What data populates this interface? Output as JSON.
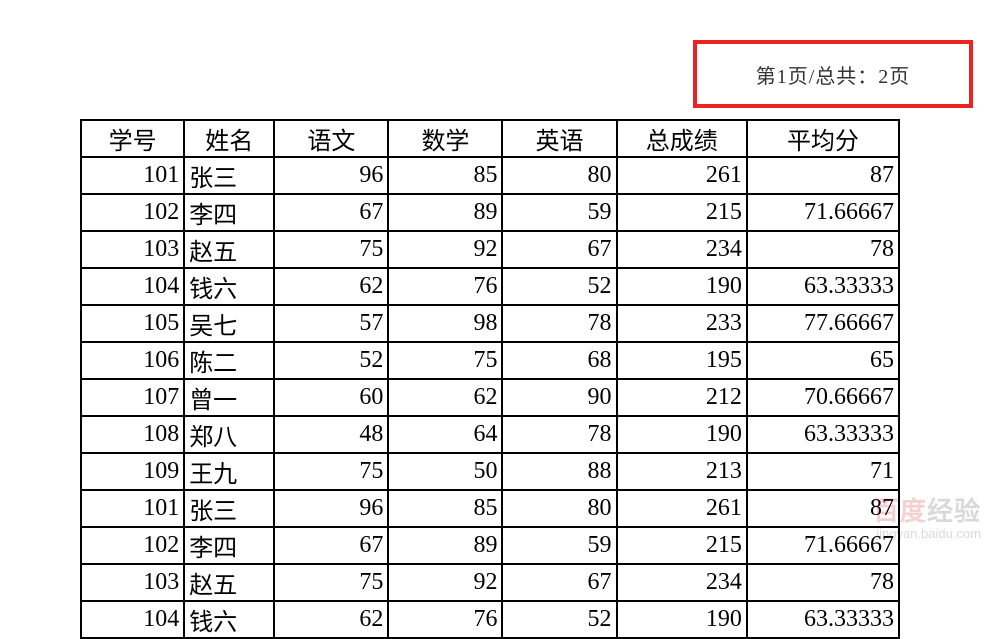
{
  "pageInfo": {
    "text": "第1页/总共：2页"
  },
  "table": {
    "headers": [
      "学号",
      "姓名",
      "语文",
      "数学",
      "英语",
      "总成绩",
      "平均分"
    ],
    "rows": [
      {
        "id": "101",
        "name": "张三",
        "c1": "96",
        "c2": "85",
        "c3": "80",
        "total": "261",
        "avg": "87"
      },
      {
        "id": "102",
        "name": "李四",
        "c1": "67",
        "c2": "89",
        "c3": "59",
        "total": "215",
        "avg": "71.66667"
      },
      {
        "id": "103",
        "name": "赵五",
        "c1": "75",
        "c2": "92",
        "c3": "67",
        "total": "234",
        "avg": "78"
      },
      {
        "id": "104",
        "name": "钱六",
        "c1": "62",
        "c2": "76",
        "c3": "52",
        "total": "190",
        "avg": "63.33333"
      },
      {
        "id": "105",
        "name": "吴七",
        "c1": "57",
        "c2": "98",
        "c3": "78",
        "total": "233",
        "avg": "77.66667"
      },
      {
        "id": "106",
        "name": "陈二",
        "c1": "52",
        "c2": "75",
        "c3": "68",
        "total": "195",
        "avg": "65"
      },
      {
        "id": "107",
        "name": "曾一",
        "c1": "60",
        "c2": "62",
        "c3": "90",
        "total": "212",
        "avg": "70.66667"
      },
      {
        "id": "108",
        "name": "郑八",
        "c1": "48",
        "c2": "64",
        "c3": "78",
        "total": "190",
        "avg": "63.33333"
      },
      {
        "id": "109",
        "name": "王九",
        "c1": "75",
        "c2": "50",
        "c3": "88",
        "total": "213",
        "avg": "71"
      },
      {
        "id": "101",
        "name": "张三",
        "c1": "96",
        "c2": "85",
        "c3": "80",
        "total": "261",
        "avg": "87"
      },
      {
        "id": "102",
        "name": "李四",
        "c1": "67",
        "c2": "89",
        "c3": "59",
        "total": "215",
        "avg": "71.66667"
      },
      {
        "id": "103",
        "name": "赵五",
        "c1": "75",
        "c2": "92",
        "c3": "67",
        "total": "234",
        "avg": "78"
      },
      {
        "id": "104",
        "name": "钱六",
        "c1": "62",
        "c2": "76",
        "c3": "52",
        "total": "190",
        "avg": "63.33333"
      }
    ]
  },
  "watermark": {
    "brand_prefix": "百度",
    "brand_suffix": "经验",
    "sub": "jingyan.baidu.com"
  }
}
